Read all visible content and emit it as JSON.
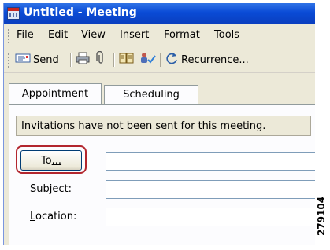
{
  "window": {
    "title": "Untitled - Meeting"
  },
  "menu": {
    "items": [
      {
        "pre": "",
        "accel": "F",
        "post": "ile"
      },
      {
        "pre": "",
        "accel": "E",
        "post": "dit"
      },
      {
        "pre": "",
        "accel": "V",
        "post": "iew"
      },
      {
        "pre": "",
        "accel": "I",
        "post": "nsert"
      },
      {
        "pre": "F",
        "accel": "o",
        "post": "rmat"
      },
      {
        "pre": "",
        "accel": "T",
        "post": "ools"
      }
    ]
  },
  "toolbar": {
    "send": {
      "pre": "",
      "accel": "S",
      "post": "end"
    },
    "recurrence": {
      "pre": "Rec",
      "accel": "u",
      "post": "rrence..."
    },
    "icons": [
      "send-icon",
      "print-icon",
      "attach-icon",
      "address-book-icon",
      "check-names-icon",
      "recurrence-icon"
    ]
  },
  "tabs": {
    "appointment": "Appointment",
    "scheduling": "Scheduling"
  },
  "infobar": {
    "text": "Invitations have not been sent for this meeting."
  },
  "form": {
    "to_button": {
      "pre": "To",
      "accel": "",
      "post": "..."
    },
    "subject_label": "Subject:",
    "location": {
      "pre": "",
      "accel": "L",
      "post": "ocation:"
    },
    "to_value": "",
    "subject_value": "",
    "location_value": ""
  },
  "figure_id": "279104",
  "colors": {
    "titlebar": "#0a4bd6",
    "highlight": "#b3262e",
    "window_bg": "#ece9d8"
  }
}
